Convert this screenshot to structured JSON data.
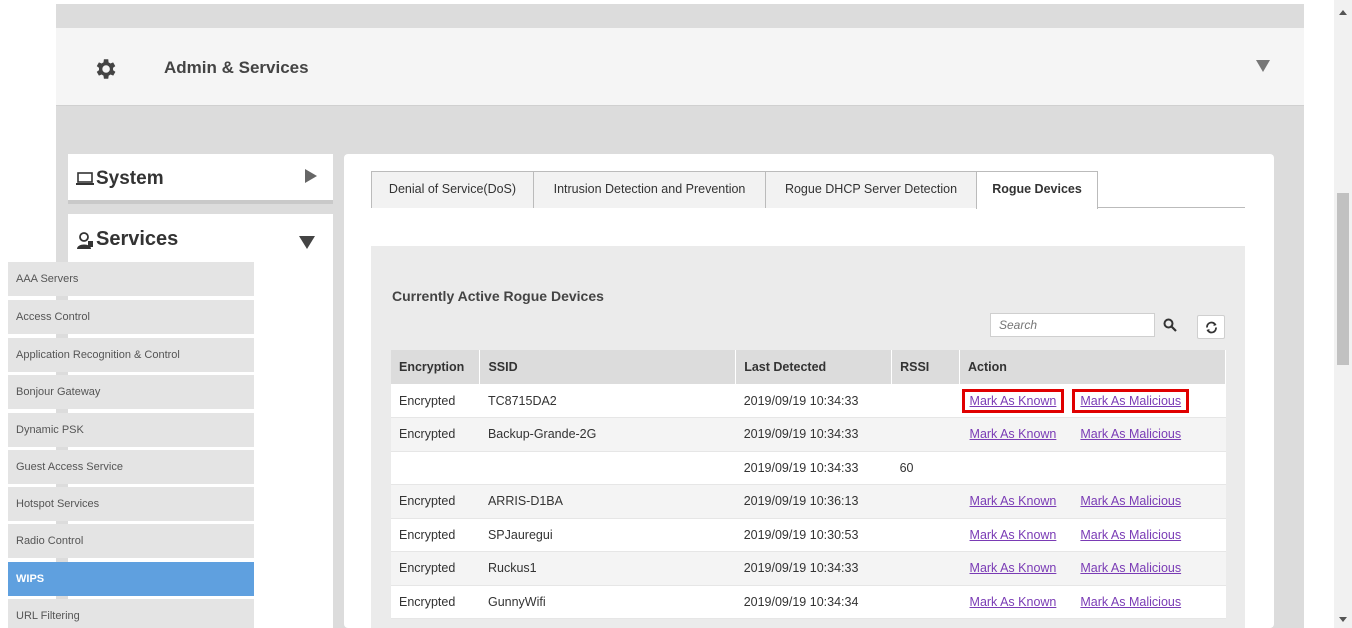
{
  "header": {
    "title": "Admin & Services"
  },
  "sidebar": {
    "system_label": "System",
    "services_label": "Services",
    "items": [
      {
        "label": "AAA Servers"
      },
      {
        "label": "Access Control"
      },
      {
        "label": "Application Recognition & Control"
      },
      {
        "label": "Bonjour Gateway"
      },
      {
        "label": "Dynamic PSK"
      },
      {
        "label": "Guest Access Service"
      },
      {
        "label": "Hotspot Services"
      },
      {
        "label": "Radio Control"
      },
      {
        "label": "WIPS"
      },
      {
        "label": "URL Filtering"
      }
    ],
    "active_item": "WIPS"
  },
  "tabs": [
    {
      "label": "Denial of Service(DoS)"
    },
    {
      "label": "Intrusion Detection and Prevention"
    },
    {
      "label": "Rogue DHCP Server Detection"
    },
    {
      "label": "Rogue Devices"
    }
  ],
  "active_tab": "Rogue Devices",
  "section": {
    "title": "Currently Active Rogue Devices"
  },
  "search": {
    "placeholder": "Search"
  },
  "table": {
    "headers": [
      "Encryption",
      "SSID",
      "Last Detected",
      "RSSI",
      "Action"
    ],
    "rows": [
      {
        "encryption": "Encrypted",
        "ssid": "TC8715DA2",
        "last_detected": "2019/09/19 10:34:33",
        "rssi": "",
        "known": "Mark As Known",
        "malicious": "Mark As Malicious"
      },
      {
        "encryption": "Encrypted",
        "ssid": "Backup-Grande-2G",
        "last_detected": "2019/09/19 10:34:33",
        "rssi": "",
        "known": "Mark As Known",
        "malicious": "Mark As Malicious"
      },
      {
        "encryption": "",
        "ssid": "",
        "last_detected": "2019/09/19 10:34:33",
        "rssi": "60",
        "known": "",
        "malicious": ""
      },
      {
        "encryption": "Encrypted",
        "ssid": "ARRIS-D1BA",
        "last_detected": "2019/09/19 10:36:13",
        "rssi": "",
        "known": "Mark As Known",
        "malicious": "Mark As Malicious"
      },
      {
        "encryption": "Encrypted",
        "ssid": "SPJauregui",
        "last_detected": "2019/09/19 10:30:53",
        "rssi": "",
        "known": "Mark As Known",
        "malicious": "Mark As Malicious"
      },
      {
        "encryption": "Encrypted",
        "ssid": "Ruckus1",
        "last_detected": "2019/09/19 10:34:33",
        "rssi": "",
        "known": "Mark As Known",
        "malicious": "Mark As Malicious"
      },
      {
        "encryption": "Encrypted",
        "ssid": "GunnyWifi",
        "last_detected": "2019/09/19 10:34:34",
        "rssi": "",
        "known": "Mark As Known",
        "malicious": "Mark As Malicious"
      }
    ]
  },
  "colors": {
    "highlight": "#e00000",
    "link": "#7a3bb5",
    "active_item": "#5fa0df"
  },
  "icons": [
    "gear-icon",
    "laptop-icon",
    "services-icon",
    "search-icon",
    "refresh-icon"
  ]
}
